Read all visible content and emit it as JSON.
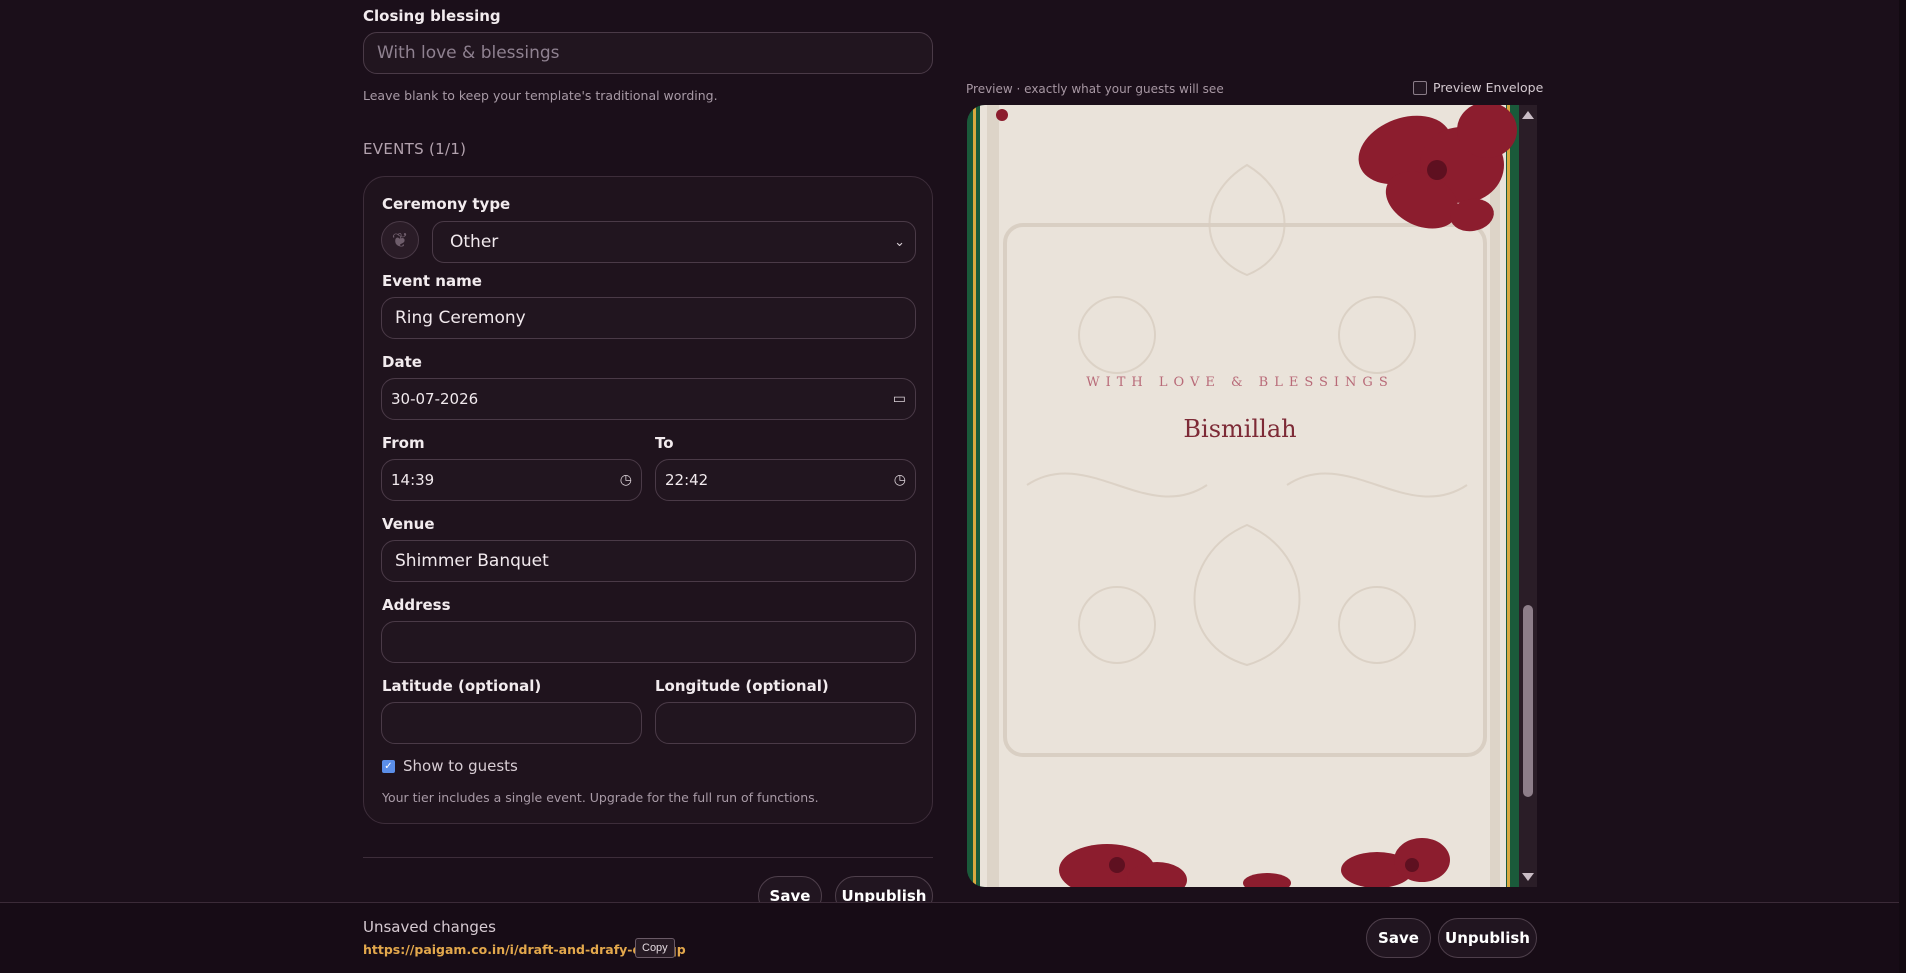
{
  "form": {
    "closing_blessing": {
      "label": "Closing blessing",
      "placeholder": "With love & blessings",
      "hint": "Leave blank to keep your template's traditional wording."
    },
    "events_title": "EVENTS (1/1)",
    "event": {
      "ceremony_type_label": "Ceremony type",
      "ceremony_type_value": "Other",
      "event_name_label": "Event name",
      "event_name_value": "Ring Ceremony",
      "date_label": "Date",
      "date_value": "30-07-2026",
      "from_label": "From",
      "from_value": "14:39",
      "to_label": "To",
      "to_value": "22:42",
      "venue_label": "Venue",
      "venue_value": "Shimmer Banquet",
      "address_label": "Address",
      "address_value": "",
      "latitude_label": "Latitude (optional)",
      "latitude_value": "",
      "longitude_label": "Longitude (optional)",
      "longitude_value": "",
      "show_to_guests_label": "Show to guests",
      "show_to_guests_checked": true,
      "tier_note": "Your tier includes a single event. Upgrade for the full run of functions."
    },
    "save_label": "Save",
    "unpublish_label": "Unpublish"
  },
  "preview": {
    "caption": "Preview · exactly what your guests will see",
    "envelope_toggle_label": "Preview Envelope",
    "envelope_checked": false,
    "kicker": "WITH LOVE & BLESSINGS",
    "title": "Bismillah"
  },
  "bottom_bar": {
    "status": "Unsaved changes",
    "share_url": "https://paigam.co.in/i/draft-and-drafy-dp73qp",
    "copy_label": "Copy",
    "save_label": "Save",
    "unpublish_label": "Unpublish"
  },
  "colors": {
    "background": "#1b0f1a",
    "accent_link": "#e3a84c",
    "checkbox": "#5b8ee8",
    "card_ivory": "#eae3da",
    "floral_red": "#8c1d2e",
    "border_green": "#1a5a3a"
  },
  "icons": [
    "ceremony-type-icon",
    "chevron-down-icon",
    "calendar-icon",
    "clock-icon",
    "checkbox-checked-icon"
  ]
}
